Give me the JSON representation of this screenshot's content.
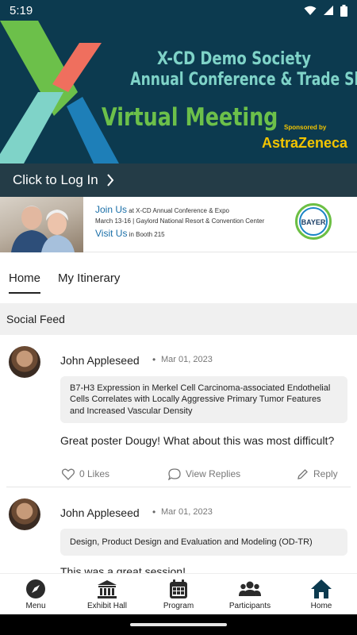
{
  "status_bar": {
    "time": "5:19"
  },
  "hero": {
    "org_line": "X-CD Demo Society",
    "event_line": "Annual Conference & Trade Show",
    "headline": "Virtual Meeting",
    "sponsored_by": "Sponsored by",
    "sponsor": "AstraZeneca",
    "colors": {
      "background": "#0c3a4f",
      "green": "#6cc04a",
      "teal": "#7fd3c8",
      "coral": "#ef6f5e",
      "blue": "#1e7fb8"
    }
  },
  "login": {
    "label": "Click to Log In",
    "icon": "chevron-right-icon"
  },
  "ad": {
    "join_label": "Join Us",
    "join_text": "at X-CD Annual Conference & Expo",
    "dates_venue": "March 13-16 | Gaylord National Resort & Convention Center",
    "visit_label": "Visit Us",
    "visit_text": "in Booth 215",
    "logo_text": "BAYER"
  },
  "tabs": [
    {
      "label": "Home",
      "active": true
    },
    {
      "label": "My Itinerary",
      "active": false
    }
  ],
  "social_feed": {
    "title": "Social Feed",
    "posts": [
      {
        "author": "John Appleseed",
        "date": "Mar 01, 2023",
        "quote": "B7-H3 Expression in Merkel Cell Carcinoma-associated Endothelial Cells Correlates with Locally Aggressive Primary Tumor Features and Increased Vascular Density",
        "body": "Great poster Dougy! What about this was most difficult?",
        "likes": "0 Likes",
        "view_replies": "View Replies",
        "reply": "Reply"
      },
      {
        "author": "John Appleseed",
        "date": "Mar 01, 2023",
        "quote": "Design, Product Design and Evaluation and Modeling (OD-TR)",
        "body": "This was a great session!"
      }
    ]
  },
  "bottom_nav": [
    {
      "label": "Menu",
      "icon": "compass-icon",
      "active": false
    },
    {
      "label": "Exhibit Hall",
      "icon": "building-icon",
      "active": false
    },
    {
      "label": "Program",
      "icon": "calendar-icon",
      "active": false
    },
    {
      "label": "Participants",
      "icon": "people-icon",
      "active": false
    },
    {
      "label": "Home",
      "icon": "home-icon",
      "active": true
    }
  ],
  "colors": {
    "nav_active": "#0c3a4f",
    "login_bar": "#243c47",
    "feed_header": "#f0f0f0"
  }
}
